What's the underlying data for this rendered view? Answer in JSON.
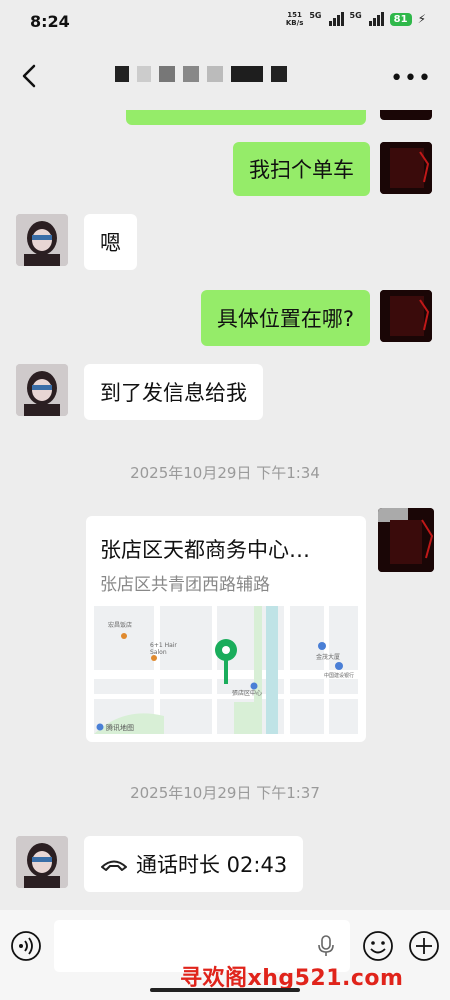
{
  "status": {
    "time": "8:24",
    "net_speed_value": "151",
    "net_speed_unit": "KB/s",
    "signal_label": "5G",
    "battery": "81"
  },
  "nav": {
    "title": ""
  },
  "messages": {
    "m1": "我扫个单车",
    "m2": "嗯",
    "m3": "具体位置在哪?",
    "m4": "到了发信息给我",
    "ts1": "2025年10月29日 下午1:34",
    "location": {
      "title": "张店区天都商务中心…",
      "address": "张店区共青团西路辅路"
    },
    "map_labels": {
      "poi1": "宏昌饭店",
      "poi2": "6+1 Hair Salon",
      "poi3": "張店区中心",
      "poi4": "金茂大厦",
      "poi5": "中国建设银行",
      "poi6": "腾讯地图"
    },
    "ts2": "2025年10月29日 下午1:37",
    "call": "通话时长 02:43"
  },
  "input": {
    "placeholder": ""
  },
  "watermark": "寻欢阁xhg521.com",
  "colors": {
    "sent_bubble": "#95ec69",
    "received_bubble": "#ffffff",
    "background": "#ededed",
    "map_pin": "#1aad5c"
  }
}
